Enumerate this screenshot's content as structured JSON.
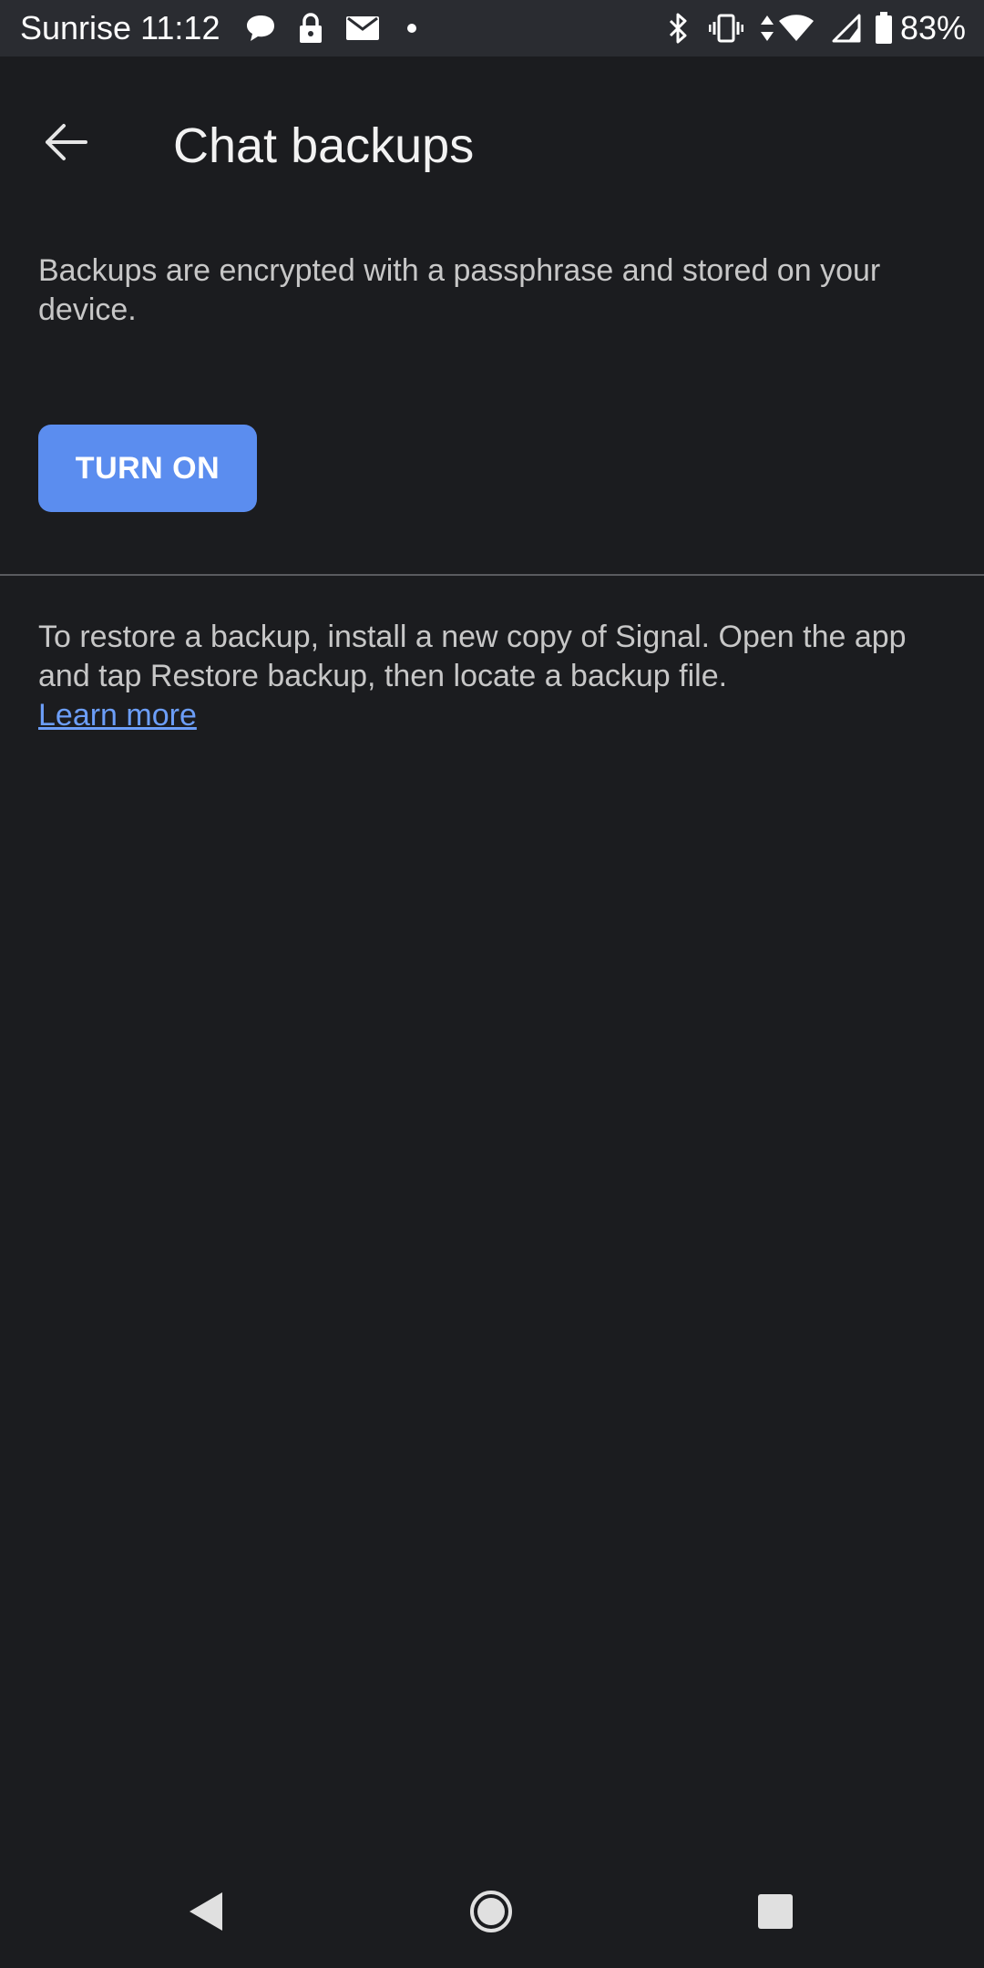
{
  "status_bar": {
    "carrier": "Sunrise",
    "time": "11:12",
    "battery": "83%",
    "left_icons": [
      "chat-bubble-icon",
      "lock-icon",
      "mail-icon",
      "dot-icon"
    ],
    "right_icons": [
      "bluetooth-icon",
      "vibrate-icon",
      "data-arrows-icon",
      "wifi-icon",
      "cell-signal-icon",
      "battery-icon"
    ]
  },
  "app_bar": {
    "back_icon": "arrow-left-icon",
    "title": "Chat backups"
  },
  "main": {
    "description": "Backups are encrypted with a passphrase and stored on your device.",
    "turn_on_label": "TURN ON",
    "restore_text": "To restore a backup, install a new copy of Signal. Open the app and tap Restore backup, then locate a backup file.",
    "learn_more_label": "Learn more"
  },
  "nav_bar": {
    "icons": [
      "back-triangle-icon",
      "home-circle-icon",
      "recents-square-icon"
    ]
  },
  "colors": {
    "background": "#1b1c1f",
    "status_bar": "#2a2c31",
    "accent": "#5b8def",
    "link": "#6c9ef8",
    "divider": "#5a5b5f"
  }
}
